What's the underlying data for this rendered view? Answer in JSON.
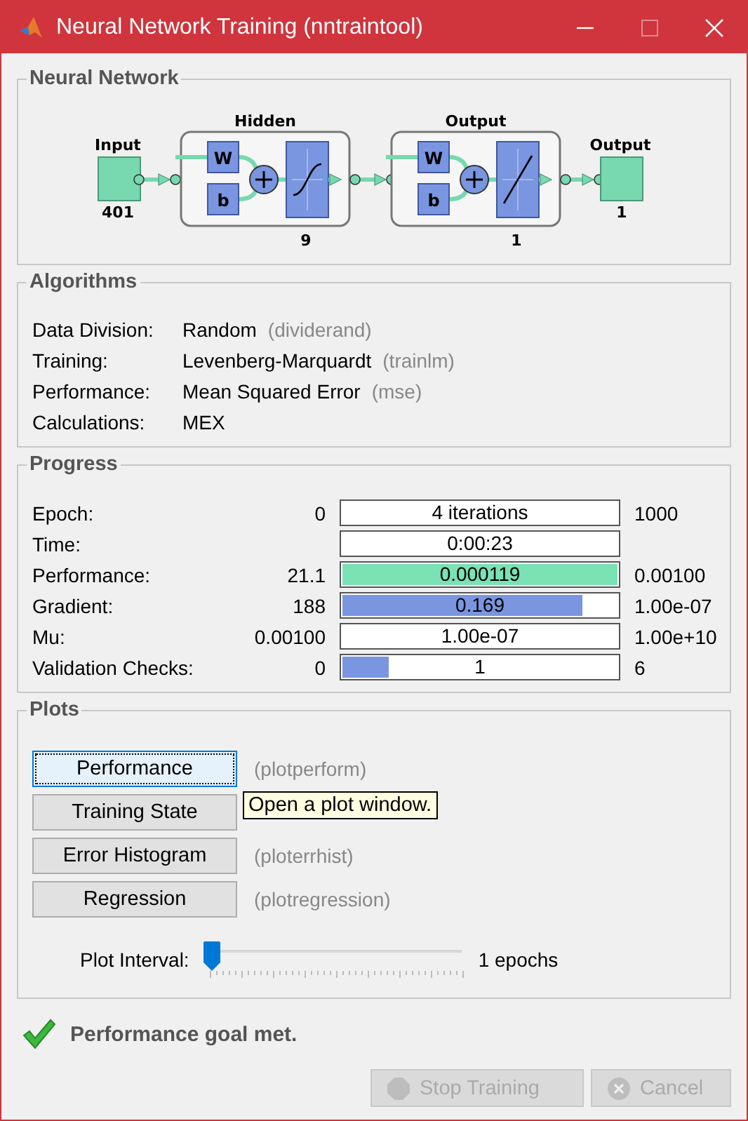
{
  "window": {
    "title": "Neural Network Training (nntraintool)",
    "controls": [
      {
        "kind": "minimize",
        "disabled": false
      },
      {
        "kind": "maximize",
        "disabled": true
      },
      {
        "kind": "close",
        "disabled": false
      }
    ]
  },
  "network": {
    "title": "Neural Network",
    "input": {
      "label": "Input",
      "size": "401"
    },
    "layers": [
      {
        "name": "Hidden",
        "size": "9",
        "weight": "W",
        "bias": "b",
        "kind": "sigmoid"
      },
      {
        "name": "Output",
        "size": "1",
        "weight": "W",
        "bias": "b",
        "kind": "linear"
      }
    ],
    "output": {
      "label": "Output",
      "size": "1"
    }
  },
  "algorithms": {
    "title": "Algorithms",
    "rows": [
      {
        "label": "Data Division:",
        "value": "Random",
        "function": "(dividerand)"
      },
      {
        "label": "Training:",
        "value": "Levenberg-Marquardt",
        "function": "(trainlm)"
      },
      {
        "label": "Performance:",
        "value": "Mean Squared Error",
        "function": "(mse)"
      },
      {
        "label": "Calculations:",
        "value": "MEX"
      }
    ]
  },
  "progress": {
    "title": "Progress",
    "rows": [
      {
        "label": "Epoch:",
        "start": "0",
        "bar_text": "4 iterations",
        "end": "1000"
      },
      {
        "label": "Time:",
        "bar_text": "0:00:23"
      },
      {
        "label": "Performance:",
        "start": "21.1",
        "bar_text": "0.000119",
        "level": 1,
        "color": "#7ae2b4",
        "end": "0.00100"
      },
      {
        "label": "Gradient:",
        "start": "188",
        "bar_text": "0.169",
        "level": 0.87,
        "color": "#7a96e0",
        "end": "1.00e-07"
      },
      {
        "label": "Mu:",
        "start": "0.00100",
        "bar_text": "1.00e-07",
        "end": "1.00e+10"
      },
      {
        "label": "Validation Checks:",
        "start": "0",
        "bar_text": "1",
        "level": 0.167,
        "color": "#7a96e0",
        "end": "6"
      }
    ]
  },
  "plots": {
    "title": "Plots",
    "buttons": [
      {
        "label": "Performance",
        "function": "(plotperform)",
        "selected": true
      },
      {
        "label": "Training State",
        "selected": false
      },
      {
        "label": "Error Histogram",
        "function": "(ploterrhist)",
        "selected": false
      },
      {
        "label": "Regression",
        "function": "(plotregression)",
        "selected": false
      }
    ],
    "tooltip": "Open a plot window.",
    "interval": {
      "label": "Plot Interval:",
      "level": 0,
      "reading": "1 epochs"
    }
  },
  "status": {
    "kind": "success",
    "text": "Performance goal met."
  },
  "buttons": [
    {
      "kind": "stop",
      "label": "Stop Training",
      "disabled": true
    },
    {
      "kind": "cancel",
      "label": "Cancel",
      "disabled": true
    }
  ]
}
